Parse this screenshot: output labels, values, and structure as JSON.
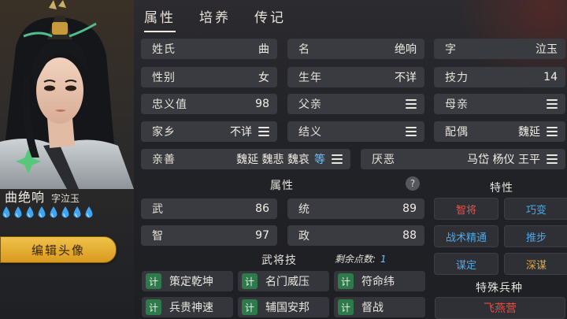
{
  "tabs": [
    "属性",
    "培养",
    "传记"
  ],
  "character": {
    "name": "曲绝响",
    "courtesy_name": "字泣玉",
    "drops_count": 8,
    "edit_portrait_label": "编辑头像"
  },
  "info": {
    "surname": {
      "label": "姓氏",
      "value": "曲"
    },
    "given_name": {
      "label": "名",
      "value": "绝响"
    },
    "courtesy": {
      "label": "字",
      "value": "泣玉"
    },
    "gender": {
      "label": "性别",
      "value": "女"
    },
    "birth_year": {
      "label": "生年",
      "value": "不详"
    },
    "skill_power": {
      "label": "技力",
      "value": "14"
    },
    "loyalty": {
      "label": "忠义值",
      "value": "98"
    },
    "father": {
      "label": "父亲"
    },
    "mother": {
      "label": "母亲"
    },
    "hometown": {
      "label": "家乡",
      "value": "不详"
    },
    "sworn": {
      "label": "结义"
    },
    "spouse": {
      "label": "配偶",
      "value": "魏延"
    },
    "likes": {
      "label": "亲善",
      "value": "魏延 魏悲 魏哀",
      "more": "等"
    },
    "dislikes": {
      "label": "厌恶",
      "value": "马岱 杨仪 王平"
    }
  },
  "attributes": {
    "title": "属性",
    "help": "?",
    "items": [
      {
        "label": "武",
        "value": "86"
      },
      {
        "label": "统",
        "value": "89"
      },
      {
        "label": "智",
        "value": "97"
      },
      {
        "label": "政",
        "value": "88"
      }
    ]
  },
  "traits": {
    "title": "特性",
    "items": [
      {
        "label": "智将",
        "color": "#e0554a"
      },
      {
        "label": "巧变",
        "color": "#4aa8e8"
      },
      {
        "label": "战术精通",
        "color": "#4aa8e8"
      },
      {
        "label": "推步",
        "color": "#4aa8e8"
      },
      {
        "label": "谋定",
        "color": "#4aa8e8"
      },
      {
        "label": "深谋",
        "color": "#e0a640"
      }
    ]
  },
  "skills": {
    "title": "武将技",
    "remaining_label": "剩余点数:",
    "remaining_value": "1",
    "tag": "计",
    "items": [
      "策定乾坤",
      "名门威压",
      "符命纬",
      "兵贵神速",
      "辅国安邦",
      "督战"
    ]
  },
  "troop": {
    "title": "特殊兵种",
    "value": "飞燕营"
  },
  "colors": {
    "edit_button": "#e9b43a",
    "skill_tag": "#2f7a4b",
    "highlight_blue": "#6fc0ff",
    "troop_red": "#e04f42"
  }
}
